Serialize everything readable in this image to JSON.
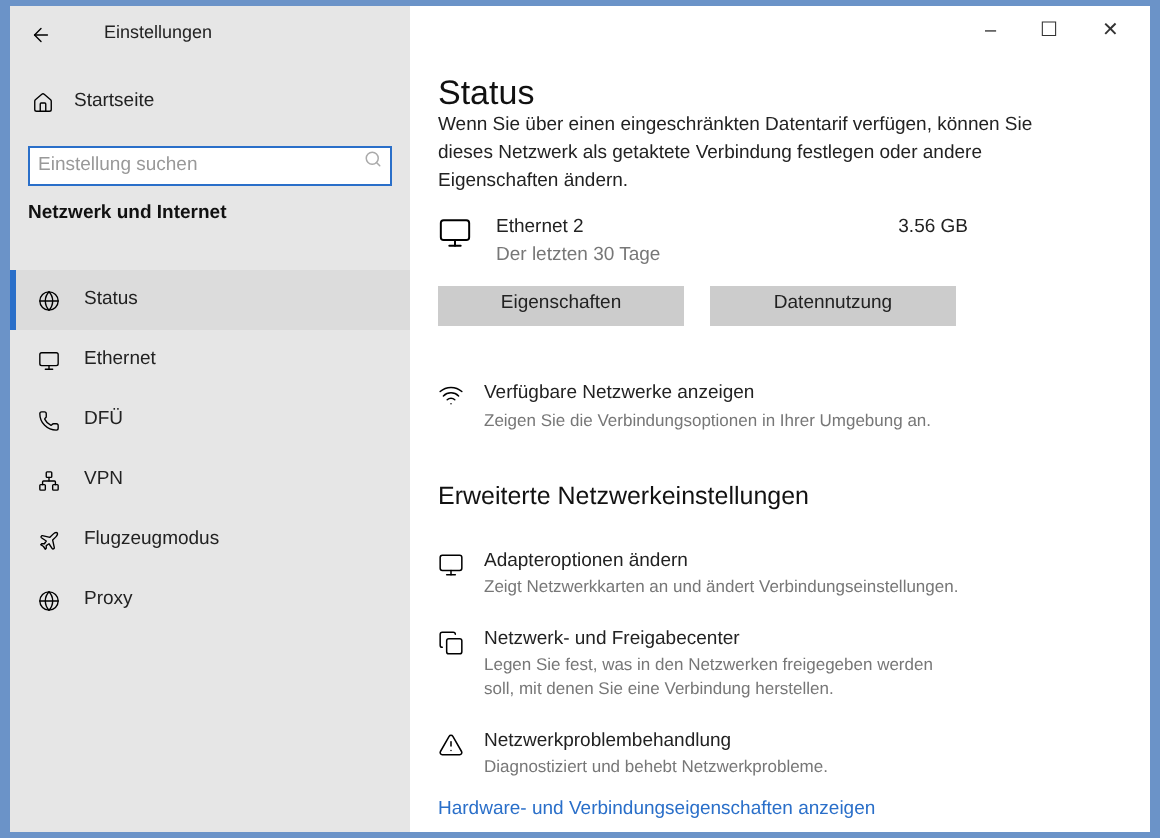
{
  "window": {
    "title": "Einstellungen",
    "controls": [
      "–",
      "☐",
      "✕"
    ]
  },
  "sidebar": {
    "home": "Startseite",
    "search": {
      "placeholder": "Einstellung suchen"
    },
    "section": "Netzwerk und Internet",
    "items": [
      {
        "label": "Status",
        "kind": "status",
        "selected": true
      },
      {
        "label": "Ethernet",
        "kind": "ethernet",
        "selected": false
      },
      {
        "label": "DFÜ",
        "kind": "dialup",
        "selected": false
      },
      {
        "label": "VPN",
        "kind": "vpn",
        "selected": false
      },
      {
        "label": "Flugzeugmodus",
        "kind": "airplane",
        "selected": false
      },
      {
        "label": "Proxy",
        "kind": "proxy",
        "selected": false
      }
    ]
  },
  "main": {
    "title": "Status",
    "intro": "Wenn Sie über einen eingeschränkten Datentarif verfügen, können Sie dieses Netzwerk als getaktete Verbindung festlegen oder andere Eigenschaften ändern.",
    "connection": {
      "name": "Ethernet 2",
      "period": "Der letzten 30 Tage",
      "usage": "3.56 GB"
    },
    "buttons": [
      "Eigenschaften",
      "Datennutzung"
    ],
    "available": {
      "title": "Verfügbare Netzwerke anzeigen",
      "description": "Zeigen Sie die Verbindungsoptionen in Ihrer Umgebung an."
    },
    "advanced_heading": "Erweiterte Netzwerkeinstellungen",
    "advanced": [
      {
        "kind": "adapter",
        "title": "Adapteroptionen ändern",
        "description": "Zeigt Netzwerkkarten an und ändert Verbindungseinstellungen."
      },
      {
        "kind": "sharing",
        "title": "Netzwerk- und Freigabecenter",
        "description": "Legen Sie fest, was in den Netzwerken freigegeben werden soll, mit denen Sie eine Verbindung herstellen."
      },
      {
        "kind": "troubleshoot",
        "title": "Netzwerkproblembehandlung",
        "description": "Diagnostiziert und behebt Netzwerkprobleme."
      }
    ],
    "link": "Hardware- und Verbindungseigenschaften anzeigen"
  }
}
